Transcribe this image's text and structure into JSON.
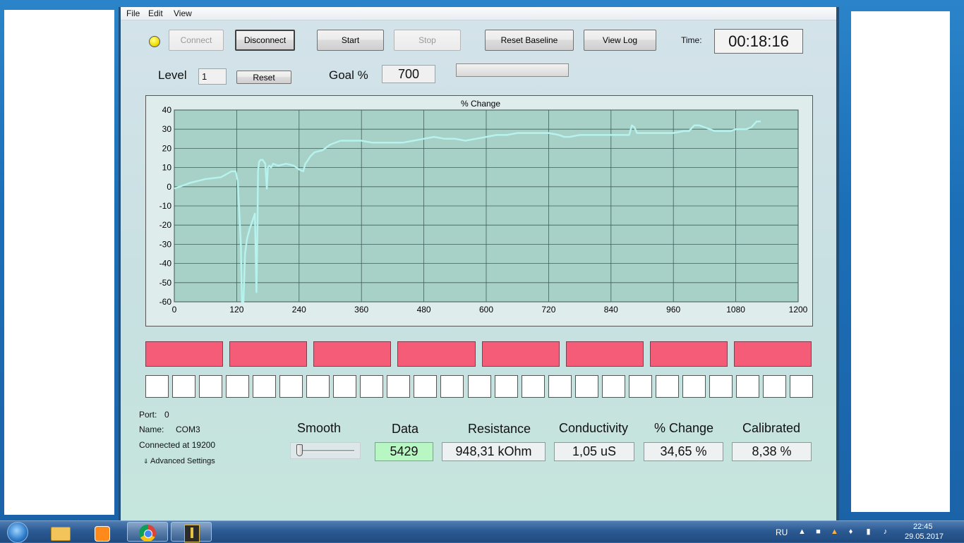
{
  "menu": {
    "items": [
      "File",
      "Edit",
      "View"
    ]
  },
  "toolbar": {
    "connect": "Connect",
    "disconnect": "Disconnect",
    "start": "Start",
    "stop": "Stop",
    "reset_baseline": "Reset Baseline",
    "view_log": "View Log",
    "time_label": "Time:",
    "time_value": "00:18:16",
    "status_led_color": "#f0e000"
  },
  "level_row": {
    "level_label": "Level",
    "level_value": "1",
    "reset": "Reset",
    "goal_label": "Goal %",
    "goal_value": "700",
    "progress": 0
  },
  "chart_data": {
    "type": "line",
    "title": "% Change",
    "xlabel": "",
    "ylabel": "",
    "xlim": [
      0,
      1200
    ],
    "ylim": [
      -60,
      40
    ],
    "xticks": [
      0,
      120,
      240,
      360,
      480,
      600,
      720,
      840,
      960,
      1080,
      1200
    ],
    "yticks": [
      40,
      30,
      20,
      10,
      0,
      -10,
      -20,
      -30,
      -40,
      -50,
      -60
    ],
    "grid": true,
    "line_color": "#b6f2ee",
    "plot_background": "#a7d0c6",
    "series": [
      {
        "x": [
          0,
          10,
          30,
          60,
          90,
          110,
          118,
          122,
          128,
          130,
          133,
          136,
          140,
          145,
          150,
          155,
          158,
          160,
          161,
          163,
          166,
          170,
          175,
          178,
          180,
          183,
          186,
          190,
          200,
          215,
          230,
          240,
          248,
          252,
          255,
          262,
          270,
          285,
          300,
          320,
          340,
          360,
          380,
          400,
          420,
          440,
          460,
          480,
          500,
          520,
          540,
          560,
          580,
          600,
          620,
          640,
          660,
          680,
          700,
          720,
          740,
          750,
          760,
          780,
          800,
          820,
          840,
          860,
          875,
          880,
          885,
          890,
          900,
          920,
          940,
          960,
          980,
          990,
          1000,
          1010,
          1020,
          1040,
          1060,
          1070,
          1080,
          1090,
          1100,
          1110,
          1120,
          1128
        ],
        "y": [
          -1,
          0,
          2,
          4,
          5,
          8,
          8,
          3,
          -30,
          -60,
          -60,
          -35,
          -27,
          -22,
          -18,
          -14,
          -55,
          -20,
          8,
          13,
          14,
          14,
          12,
          -1,
          10,
          11,
          10,
          12,
          11,
          12,
          11,
          9,
          8,
          12,
          13,
          16,
          18,
          19,
          22,
          24,
          24,
          24,
          23,
          23,
          23,
          23,
          24,
          25,
          26,
          25,
          25,
          24,
          25,
          26,
          27,
          27,
          28,
          28,
          28,
          28,
          27,
          26,
          26,
          27,
          27,
          27,
          27,
          27,
          27,
          32,
          31,
          28,
          28,
          28,
          28,
          28,
          29,
          29,
          32,
          32,
          31,
          29,
          29,
          29,
          30,
          30,
          30,
          31,
          34,
          34
        ]
      }
    ]
  },
  "zones": {
    "count": 8,
    "color": "#f45c78"
  },
  "cells": {
    "count": 25
  },
  "connection": {
    "port_label": "Port:",
    "port_value": "0",
    "name_label": "Name:",
    "name_value": "COM3",
    "status": "Connected at 19200",
    "advanced": "Advanced Settings"
  },
  "metrics": {
    "smooth_label": "Smooth",
    "smooth_level": 0,
    "data_label": "Data",
    "data_value": "5429",
    "data_color": "#b8f7c4",
    "resistance_label": "Resistance",
    "resistance_value": "948,31 kOhm",
    "conductivity_label": "Conductivity",
    "conductivity_value": "1,05 uS",
    "change_label": "% Change",
    "change_value": "34,65 %",
    "calibrated_label": "Calibrated",
    "calibrated_value": "8,38 %"
  },
  "taskbar": {
    "language": "RU",
    "clock_time": "22:45",
    "clock_date": "29.05.2017"
  }
}
